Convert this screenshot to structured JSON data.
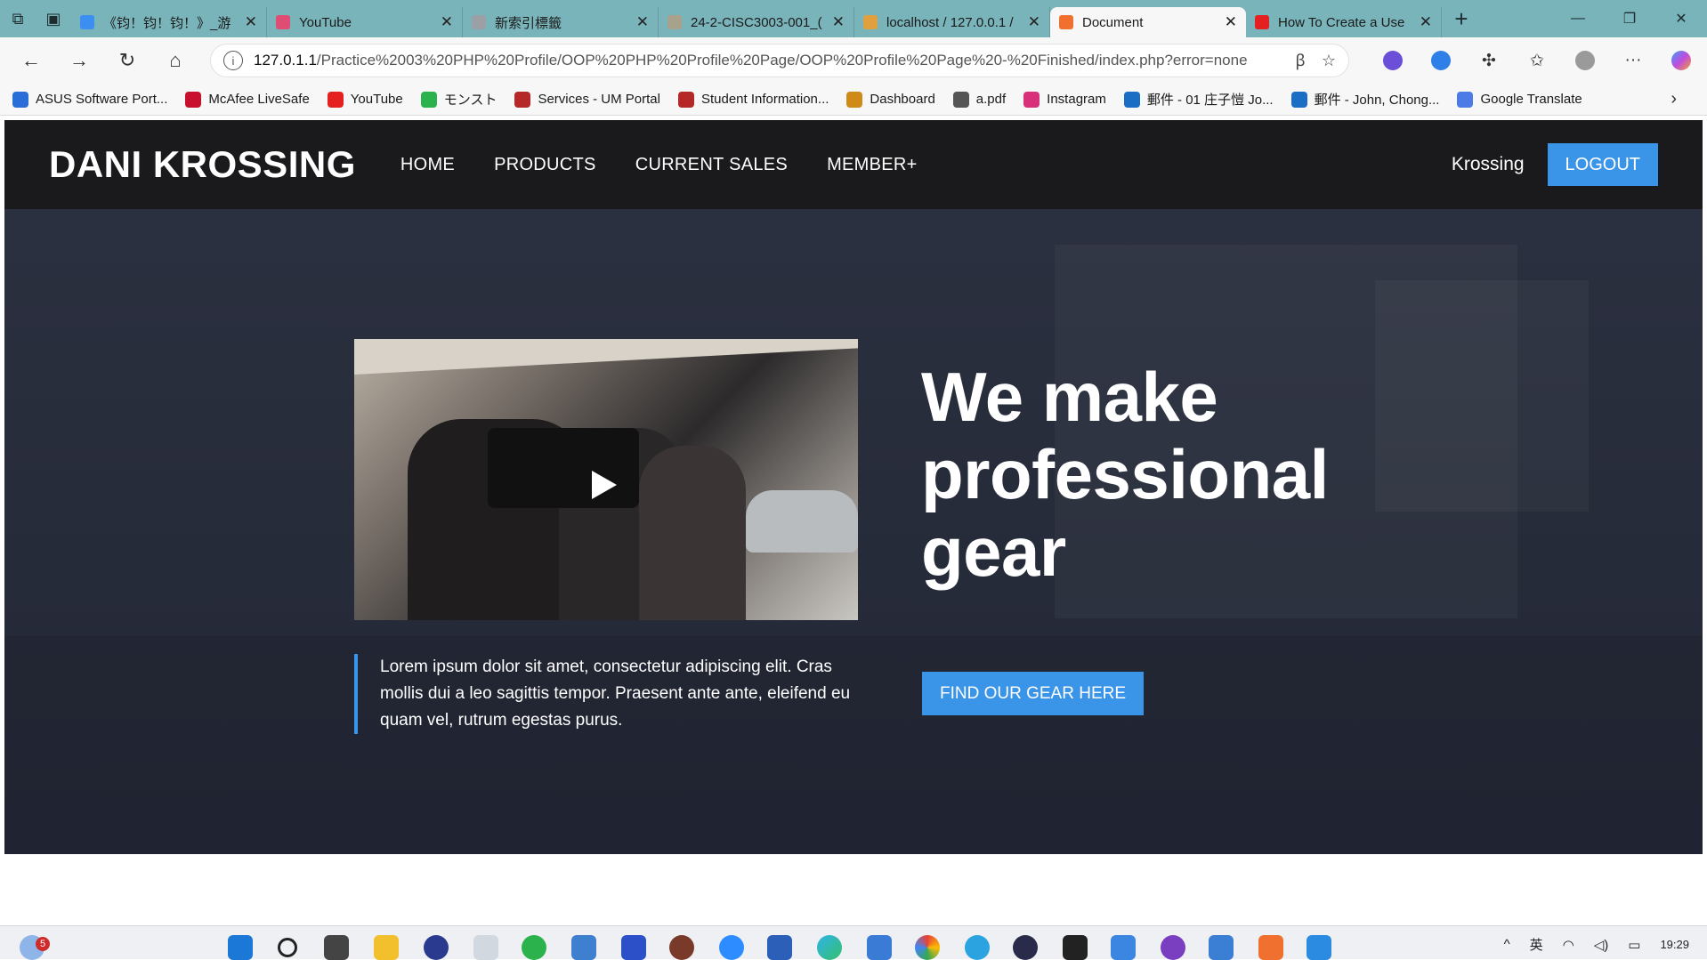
{
  "browser": {
    "tabs": [
      {
        "label": "《钧！钧！钧！》_游",
        "color": "#3b8ff0",
        "active": false
      },
      {
        "label": "YouTube",
        "color": "#e04d74",
        "active": false
      },
      {
        "label": "新索引標籤",
        "color": "#9aa0a6",
        "active": false
      },
      {
        "label": "24-2-CISC3003-001_(",
        "color": "#a8a28c",
        "active": false
      },
      {
        "label": "localhost / 127.0.0.1 /",
        "color": "#e0a040",
        "active": false
      },
      {
        "label": "Document",
        "color": "#f07030",
        "active": true
      },
      {
        "label": "How To Create a Use",
        "color": "#e52020",
        "active": false
      }
    ],
    "url_prefix": "127.0.1.1",
    "url_rest": "/Practice%2003%20PHP%20Profile/OOP%20PHP%20Profile%20Page/OOP%20Profile%20Page%20-%20Finished/index.php?error=none",
    "bookmarks": [
      {
        "label": "ASUS Software Port...",
        "color": "#2a6dd8"
      },
      {
        "label": "McAfee LiveSafe",
        "color": "#c8102e"
      },
      {
        "label": "YouTube",
        "color": "#e52020"
      },
      {
        "label": "モンスト",
        "color": "#2bb24c"
      },
      {
        "label": "Services - UM Portal",
        "color": "#b52828"
      },
      {
        "label": "Student Information...",
        "color": "#b52828"
      },
      {
        "label": "Dashboard",
        "color": "#d08a1a"
      },
      {
        "label": "a.pdf",
        "color": "#555555"
      },
      {
        "label": "Instagram",
        "color": "#d8307a"
      },
      {
        "label": "郵件 - 01 庄子愷 Jo...",
        "color": "#1a6fc4"
      },
      {
        "label": "郵件 - John, Chong...",
        "color": "#1a6fc4"
      },
      {
        "label": "Google Translate",
        "color": "#4a7be6"
      }
    ]
  },
  "site": {
    "logo": "DANI KROSSING",
    "menu": [
      "HOME",
      "PRODUCTS",
      "CURRENT SALES",
      "MEMBER+"
    ],
    "username": "Krossing",
    "logout_label": "LOGOUT",
    "headline": "We make professional gear",
    "quote": "Lorem ipsum dolor sit amet, consectetur adipiscing elit. Cras mollis dui a leo sagittis tempor. Praesent ante ante, eleifend eu quam vel, rutrum egestas purus.",
    "cta_label": "FIND OUR GEAR HERE",
    "accent_color": "#3a95e9"
  },
  "taskbar": {
    "notification_count": "5",
    "tray_lang": "英",
    "time": "19:29"
  }
}
